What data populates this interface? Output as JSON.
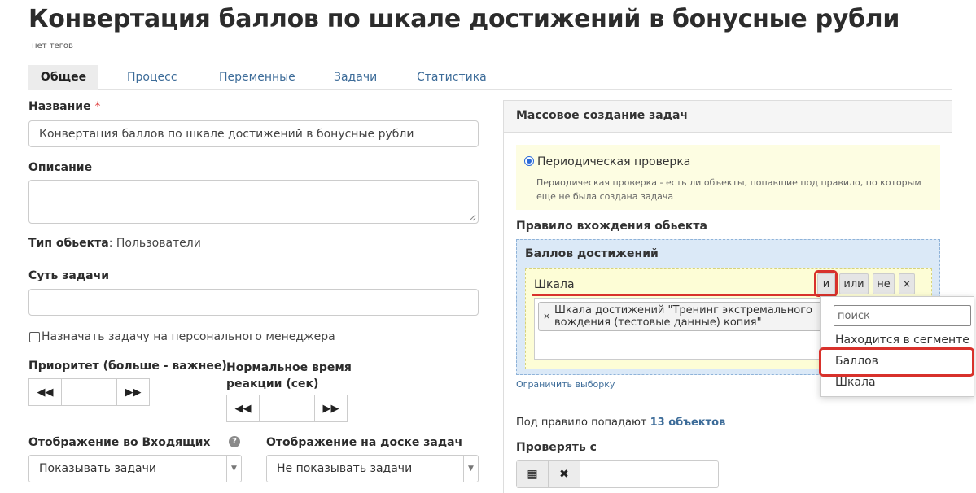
{
  "page": {
    "title": "Конвертация баллов по шкале достижений в бонусные рубли",
    "tags": "нет тегов"
  },
  "tabs": [
    {
      "label": "Общее",
      "active": true
    },
    {
      "label": "Процесс"
    },
    {
      "label": "Переменные"
    },
    {
      "label": "Задачи"
    },
    {
      "label": "Статистика"
    }
  ],
  "form": {
    "name_label": "Название",
    "required_mark": "*",
    "name_value": "Конвертация баллов по шкале достижений в бонусные рубли",
    "description_label": "Описание",
    "description_value": "",
    "object_type_label": "Тип обьекта",
    "object_type_value": ": Пользователи",
    "task_essence_label": "Суть задачи",
    "task_essence_value": "",
    "assign_manager_label": "Назначать задачу на персонального менеджера",
    "assign_manager_checked": false,
    "priority_label": "Приоритет (больше - важнее)",
    "priority_value": "",
    "reaction_time_label": "Нормальное время реакции (сек)",
    "reaction_time_value": "",
    "decrement_icon": "◀◀",
    "increment_icon": "▶▶",
    "inbox_display_label": "Отображение во Входящих",
    "inbox_display_value": "Показывать задачи",
    "board_display_label": "Отображение на доске задач",
    "board_display_value": "Не показывать задачи",
    "help_icon": "?",
    "select_arrow": "▼"
  },
  "mass_panel": {
    "title": "Массовое создание задач",
    "periodic_label": "Периодическая проверка",
    "periodic_selected": true,
    "periodic_description": "Периодическая проверка - есть ли объекты, попавшие под правило, по которым еще не была создана задача",
    "rule_label": "Правило вхождения обьекта",
    "group_title": "Баллов достижений",
    "condition_name": "Шкала",
    "logic_and": "и",
    "logic_or": "или",
    "logic_not": "не",
    "remove": "×",
    "chip_remove": "×",
    "chip_text": "Шкала достижений \"Тренинг экстремального вождения (тестовые данные) копия\"",
    "limit_link": "Ограничить выборку",
    "count_prefix": "Под правило попадают",
    "count_value": "13 объектов",
    "check_from_label": "Проверять с",
    "calendar_icon": "▦",
    "clear_icon": "✖"
  },
  "dropdown": {
    "search_placeholder": "поиск",
    "items": [
      "Находится в сегменте",
      "Баллов",
      "Шкала"
    ],
    "highlighted": "Баллов"
  },
  "colors": {
    "link": "#3d6c99",
    "highlight_red": "#d8312b",
    "radio_blue": "#2b6bd8",
    "yellow_bg": "#fdfde2",
    "blue_bg": "#dbe9f7"
  }
}
